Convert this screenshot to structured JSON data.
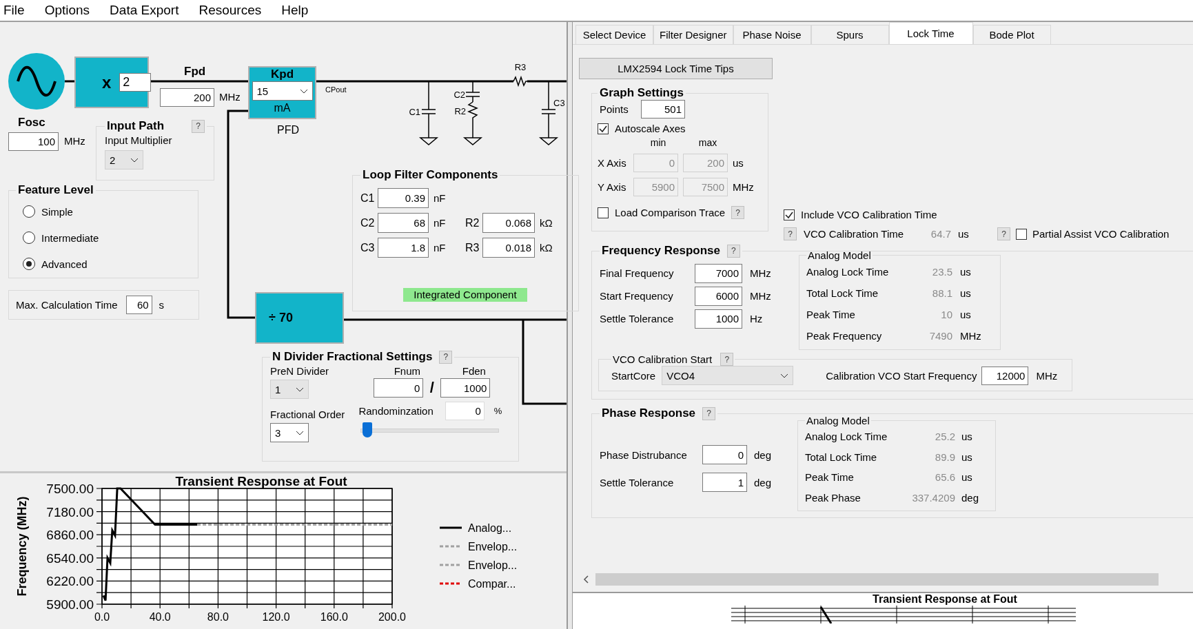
{
  "menu": [
    {
      "label": "File"
    },
    {
      "label": "Options"
    },
    {
      "label": "Data Export"
    },
    {
      "label": "Resources"
    },
    {
      "label": "Help"
    }
  ],
  "schematic": {
    "oscillator": {
      "label": "Fosc",
      "value": "100",
      "unit": "MHz"
    },
    "multiplier": {
      "symbol": "x",
      "value": "2"
    },
    "fpd": {
      "label": "Fpd",
      "value": "200",
      "unit": "MHz"
    },
    "pfd": {
      "title": "Kpd",
      "value": "15",
      "unit": "mA",
      "caption": "PFD",
      "output_label": "CPout"
    },
    "component_labels": [
      "R3",
      "C1",
      "C2",
      "R2",
      "C3"
    ],
    "n_divider": "÷ 70"
  },
  "input_path": {
    "title": "Input Path",
    "help": "?",
    "label": "Input Multiplier",
    "value": "2",
    "disabled": true
  },
  "feature_level": {
    "title": "Feature Level",
    "options": [
      {
        "label": "Simple",
        "selected": false
      },
      {
        "label": "Intermediate",
        "selected": false
      },
      {
        "label": "Advanced",
        "selected": true
      }
    ]
  },
  "max_calc": {
    "label": "Max. Calculation Time",
    "value": "60",
    "unit": "s"
  },
  "loop_filter": {
    "title": "Loop Filter Components",
    "rows": [
      [
        {
          "label": "C1",
          "value": "0.39",
          "unit": "nF"
        }
      ],
      [
        {
          "label": "C2",
          "value": "68",
          "unit": "nF"
        },
        {
          "label": "R2",
          "value": "0.068",
          "unit": "kΩ"
        }
      ],
      [
        {
          "label": "C3",
          "value": "1.8",
          "unit": "nF"
        },
        {
          "label": "R3",
          "value": "0.018",
          "unit": "kΩ"
        }
      ]
    ],
    "badge": "Integrated Component"
  },
  "n_settings": {
    "title": "N Divider Fractional Settings",
    "help": "?",
    "pren": {
      "label": "PreN Divider",
      "value": "1",
      "disabled": true
    },
    "order": {
      "label": "Fractional Order",
      "value": "3",
      "disabled": false
    },
    "fnum": {
      "label": "Fnum",
      "value": "0"
    },
    "separator": "/",
    "fden": {
      "label": "Fden",
      "value": "1000"
    },
    "randomization": {
      "label": "Randominzation",
      "value": "0",
      "unit": "%",
      "level": 0
    }
  },
  "transient_chart": {
    "chart_data": {
      "type": "line",
      "title": "Transient Response at Fout",
      "ylabel": "Frequency (MHz)",
      "x": [
        1,
        2.4,
        3.8,
        5.7,
        7.1,
        9,
        10.5,
        12.8,
        36.6,
        65.6,
        200
      ],
      "legend": "right",
      "series": [
        {
          "name": "Analog...",
          "color": "#000000",
          "line_style": "solid",
          "values": [
            6020,
            5950,
            6540,
            6470,
            6920,
            6850,
            7500,
            7500,
            7000,
            7000,
            null
          ]
        },
        {
          "name": "Envelop...",
          "color": "#a0a0a0",
          "line_style": "dashed",
          "values": [
            null,
            null,
            null,
            null,
            null,
            null,
            null,
            null,
            null,
            7000,
            7000
          ]
        },
        {
          "name": "Envelop...",
          "color": "#a0a0a0",
          "line_style": "dashed",
          "values": [
            null,
            null,
            null,
            null,
            null,
            null,
            null,
            null,
            null,
            7000,
            7000
          ]
        },
        {
          "name": "Compar...",
          "color": "#e00000",
          "line_style": "dashed",
          "values": [
            null,
            null,
            null,
            null,
            null,
            null,
            null,
            null,
            null,
            null,
            null
          ]
        }
      ],
      "xlim": [
        0,
        200
      ],
      "ylim": [
        5900,
        7500
      ],
      "xticks": [
        {
          "value": 0,
          "label": "0.0"
        },
        {
          "value": 40,
          "label": "40.0"
        },
        {
          "value": 80,
          "label": "80.0"
        },
        {
          "value": 120,
          "label": "120.0"
        },
        {
          "value": 160,
          "label": "160.0"
        },
        {
          "value": 200,
          "label": "200.0"
        }
      ],
      "yticks": [
        {
          "value": 7500,
          "label": "7500.00"
        },
        {
          "value": 7180,
          "label": "7180.00"
        },
        {
          "value": 6860,
          "label": "6860.00"
        },
        {
          "value": 6540,
          "label": "6540.00"
        },
        {
          "value": 6220,
          "label": "6220.00"
        },
        {
          "value": 5900,
          "label": "5900.00"
        }
      ]
    }
  },
  "tabs": [
    {
      "label": "Select Device",
      "selected": false
    },
    {
      "label": "Filter Designer",
      "selected": false
    },
    {
      "label": "Phase Noise",
      "selected": false
    },
    {
      "label": "Spurs",
      "selected": false
    },
    {
      "label": "Lock Time",
      "selected": true
    },
    {
      "label": "Bode Plot",
      "selected": false
    }
  ],
  "tips_button": "LMX2594 Lock Time Tips",
  "graph_settings": {
    "title": "Graph Settings",
    "points": {
      "label": "Points",
      "value": "501"
    },
    "autoscale": {
      "label": "Autoscale Axes",
      "checked": true
    },
    "min_label": "min",
    "max_label": "max",
    "axes": [
      {
        "label": "X Axis",
        "min": "0",
        "max": "200",
        "unit": "us",
        "disabled": true
      },
      {
        "label": "Y Axis",
        "min": "5900",
        "max": "7500",
        "unit": "MHz",
        "disabled": true
      }
    ],
    "comparison": {
      "label": "Load Comparison Trace",
      "checked": false,
      "help": "?"
    }
  },
  "vco_calibration": {
    "include": {
      "label": "Include VCO Calibration Time",
      "checked": true
    },
    "help": "?",
    "time_label": "VCO Calibration Time",
    "time_value": "64.7",
    "time_unit": "us",
    "partial_help": "?",
    "partial": {
      "label": "Partial Assist VCO Calibration",
      "checked": false
    }
  },
  "frequency_response": {
    "title": "Frequency Response",
    "help": "?",
    "inputs": [
      {
        "label": "Final Frequency",
        "value": "7000",
        "unit": "MHz"
      },
      {
        "label": "Start Frequency",
        "value": "6000",
        "unit": "MHz"
      },
      {
        "label": "Settle Tolerance",
        "value": "1000",
        "unit": "Hz"
      }
    ],
    "analog_model": {
      "title": "Analog Model",
      "rows": [
        {
          "label": "Analog Lock Time",
          "value": "23.5",
          "unit": "us"
        },
        {
          "label": "Total Lock Time",
          "value": "88.1",
          "unit": "us"
        },
        {
          "label": "Peak Time",
          "value": "10",
          "unit": "us"
        },
        {
          "label": "Peak Frequency",
          "value": "7490",
          "unit": "MHz"
        }
      ]
    },
    "vco_start": {
      "title": "VCO Calibration Start",
      "help": "?",
      "startcore_label": "StartCore",
      "startcore": "VCO4",
      "freq_label": "Calibration VCO Start Frequency",
      "freq_value": "12000",
      "freq_unit": "MHz"
    }
  },
  "phase_response": {
    "title": "Phase Response",
    "help": "?",
    "inputs": [
      {
        "label": "Phase Distrubance",
        "value": "0",
        "unit": "deg"
      },
      {
        "label": "Settle Tolerance",
        "value": "1",
        "unit": "deg"
      }
    ],
    "analog_model": {
      "title": "Analog Model",
      "rows": [
        {
          "label": "Analog Lock Time",
          "value": "25.2",
          "unit": "us"
        },
        {
          "label": "Total Lock Time",
          "value": "89.9",
          "unit": "us"
        },
        {
          "label": "Peak Time",
          "value": "65.6",
          "unit": "us"
        },
        {
          "label": "Peak Phase",
          "value": "337.4209",
          "unit": "deg"
        }
      ]
    }
  },
  "lower_chart": {
    "title": "Transient Response at Fout"
  }
}
